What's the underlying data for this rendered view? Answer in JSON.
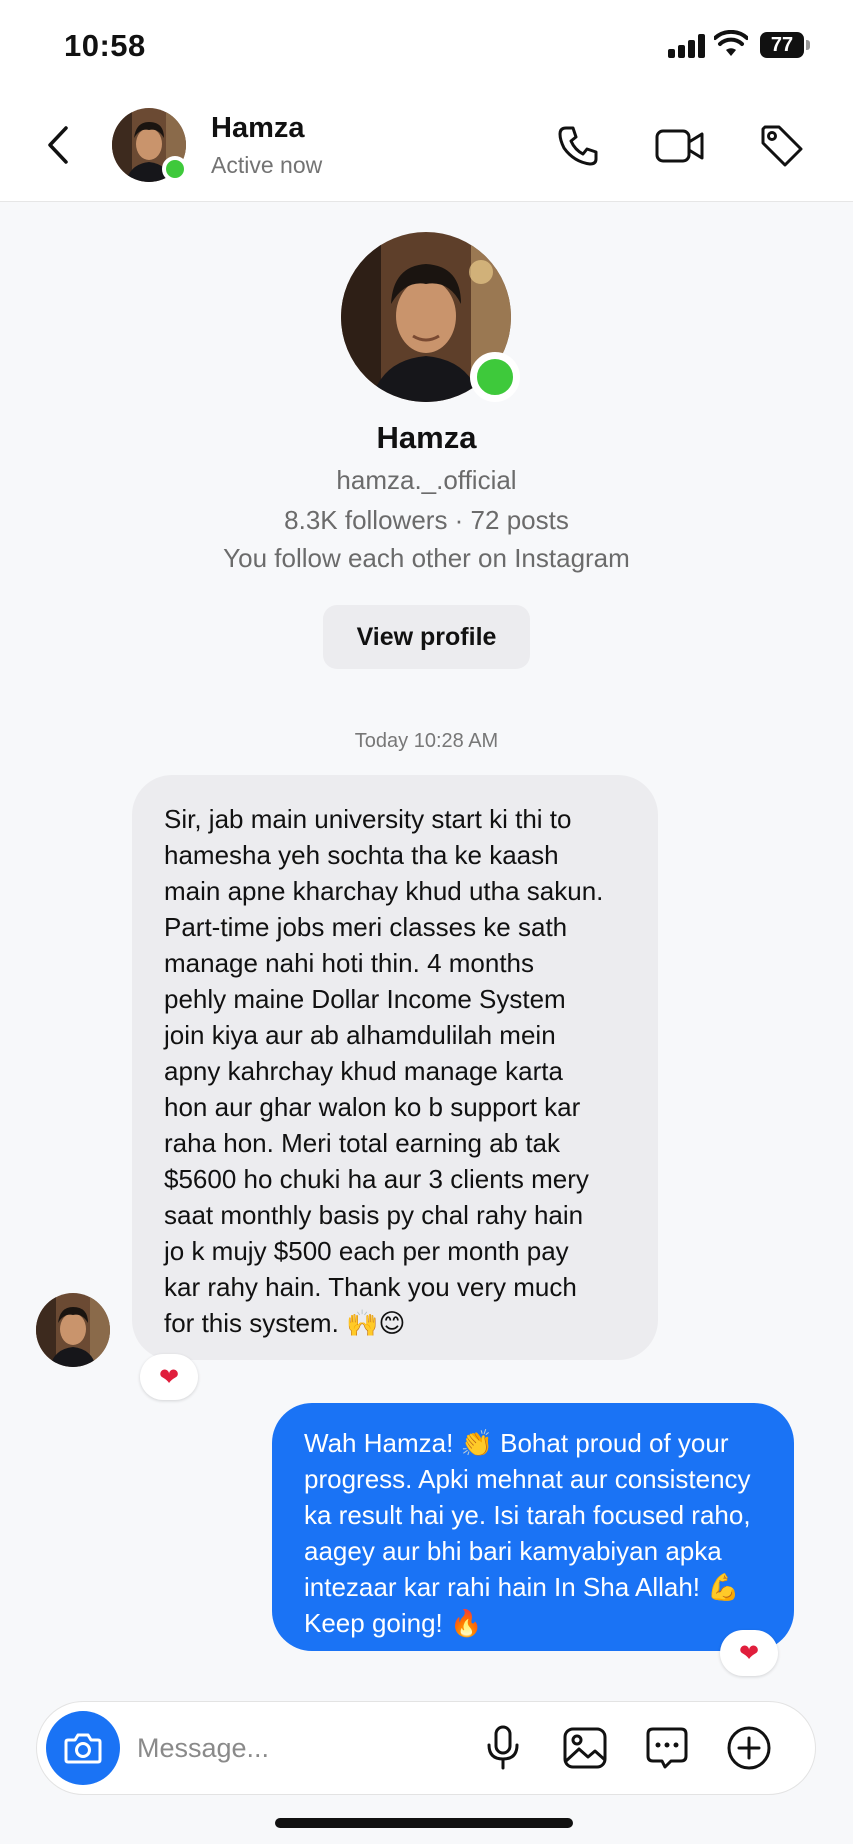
{
  "status_bar": {
    "time": "10:58",
    "battery": "77"
  },
  "header": {
    "name": "Hamza",
    "status": "Active now",
    "icons": [
      "back-chevron-icon",
      "phone-icon",
      "video-camera-icon",
      "tag-icon"
    ]
  },
  "profile": {
    "name": "Hamza",
    "username": "hamza._.official",
    "stats": "8.3K followers · 72 posts",
    "mutual": "You follow each other on Instagram",
    "view_profile_label": "View profile"
  },
  "thread": {
    "timestamp": "Today 10:28 AM",
    "incoming": {
      "text": "Sir, jab main university start ki thi to\nhamesha yeh sochta tha ke kaash\nmain apne kharchay khud utha sakun.\nPart-time jobs meri classes ke sath\nmanage nahi hoti thin. 4 months\npehly maine Dollar Income System\njoin kiya aur ab alhamdulilah mein\napny kahrchay khud manage karta\nhon aur ghar walon ko b support kar\nraha hon. Meri total earning ab tak\n$5600 ho chuki ha aur 3 clients mery\nsaat monthly basis py chal rahy hain\njo k mujy $500 each per month pay\nkar rahy hain. Thank you very much\nfor this system. 🙌😊",
      "reaction": "❤"
    },
    "outgoing": {
      "text": "Wah Hamza! 👏 Bohat proud of your\nprogress. Apki mehnat aur consistency\nka result hai ye. Isi tarah focused raho,\naagey aur bhi bari kamyabiyan apka\nintezaar kar rahi hain In Sha Allah! 💪\nKeep going! 🔥",
      "reaction": "❤"
    }
  },
  "composer": {
    "placeholder": "Message...",
    "icons": [
      "camera-icon",
      "microphone-icon",
      "gallery-icon",
      "sticker-icon",
      "plus-icon"
    ]
  },
  "colors": {
    "accent": "#1a73f5",
    "online": "#3ec93b",
    "heart": "#e01e3c"
  }
}
